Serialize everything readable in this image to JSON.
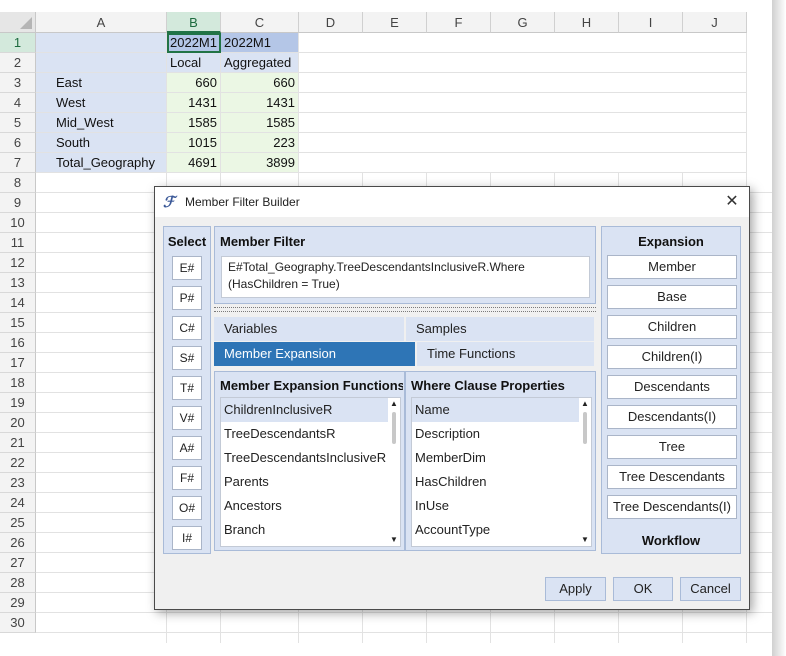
{
  "sheet": {
    "columns": [
      "A",
      "B",
      "C",
      "D",
      "E",
      "F",
      "G",
      "H",
      "I",
      "J"
    ],
    "rows": [
      "1",
      "2",
      "3",
      "4",
      "5",
      "6",
      "7",
      "8",
      "9",
      "10",
      "11",
      "12",
      "13",
      "14",
      "15",
      "16",
      "17",
      "18",
      "19",
      "20",
      "21",
      "22",
      "23",
      "24",
      "25",
      "26",
      "27",
      "28",
      "29",
      "30"
    ],
    "cells": {
      "b1": "2022M1",
      "c1": "2022M1",
      "b2": "Local",
      "c2": "Aggregated",
      "a3": "East",
      "b3": "660",
      "c3": "660",
      "a4": "West",
      "b4": "1431",
      "c4": "1431",
      "a5": "Mid_West",
      "b5": "1585",
      "c5": "1585",
      "a6": "South",
      "b6": "1015",
      "c6": "223",
      "a7": "Total_Geography",
      "b7": "4691",
      "c7": "3899"
    }
  },
  "dialog": {
    "title": "Member Filter Builder",
    "close_glyph": "✕",
    "icon_glyph": "ℱ",
    "select": {
      "title": "Select",
      "buttons": [
        "E#",
        "P#",
        "C#",
        "S#",
        "T#",
        "V#",
        "A#",
        "F#",
        "O#",
        "I#"
      ]
    },
    "member_filter": {
      "title": "Member Filter",
      "line1": "E#Total_Geography.TreeDescendantsInclusiveR.Where",
      "line2": "(HasChildren = True)"
    },
    "tabs": {
      "variables": "Variables",
      "samples": "Samples",
      "member_expansion": "Member Expansion",
      "time_functions": "Time Functions"
    },
    "functions": {
      "title": "Member Expansion Functions",
      "items": [
        "ChildrenInclusiveR",
        "TreeDescendantsR",
        "TreeDescendantsInclusiveR",
        "Parents",
        "Ancestors",
        "Branch"
      ]
    },
    "where": {
      "title": "Where Clause Properties",
      "items": [
        "Name",
        "Description",
        "MemberDim",
        "HasChildren",
        "InUse",
        "AccountType"
      ]
    },
    "expansion": {
      "title": "Expansion",
      "buttons": [
        "Member",
        "Base",
        "Children",
        "Children(I)",
        "Descendants",
        "Descendants(I)",
        "Tree",
        "Tree Descendants",
        "Tree Descendants(I)"
      ],
      "workflow": "Workflow"
    },
    "footer": {
      "apply": "Apply",
      "ok": "OK",
      "cancel": "Cancel"
    }
  }
}
